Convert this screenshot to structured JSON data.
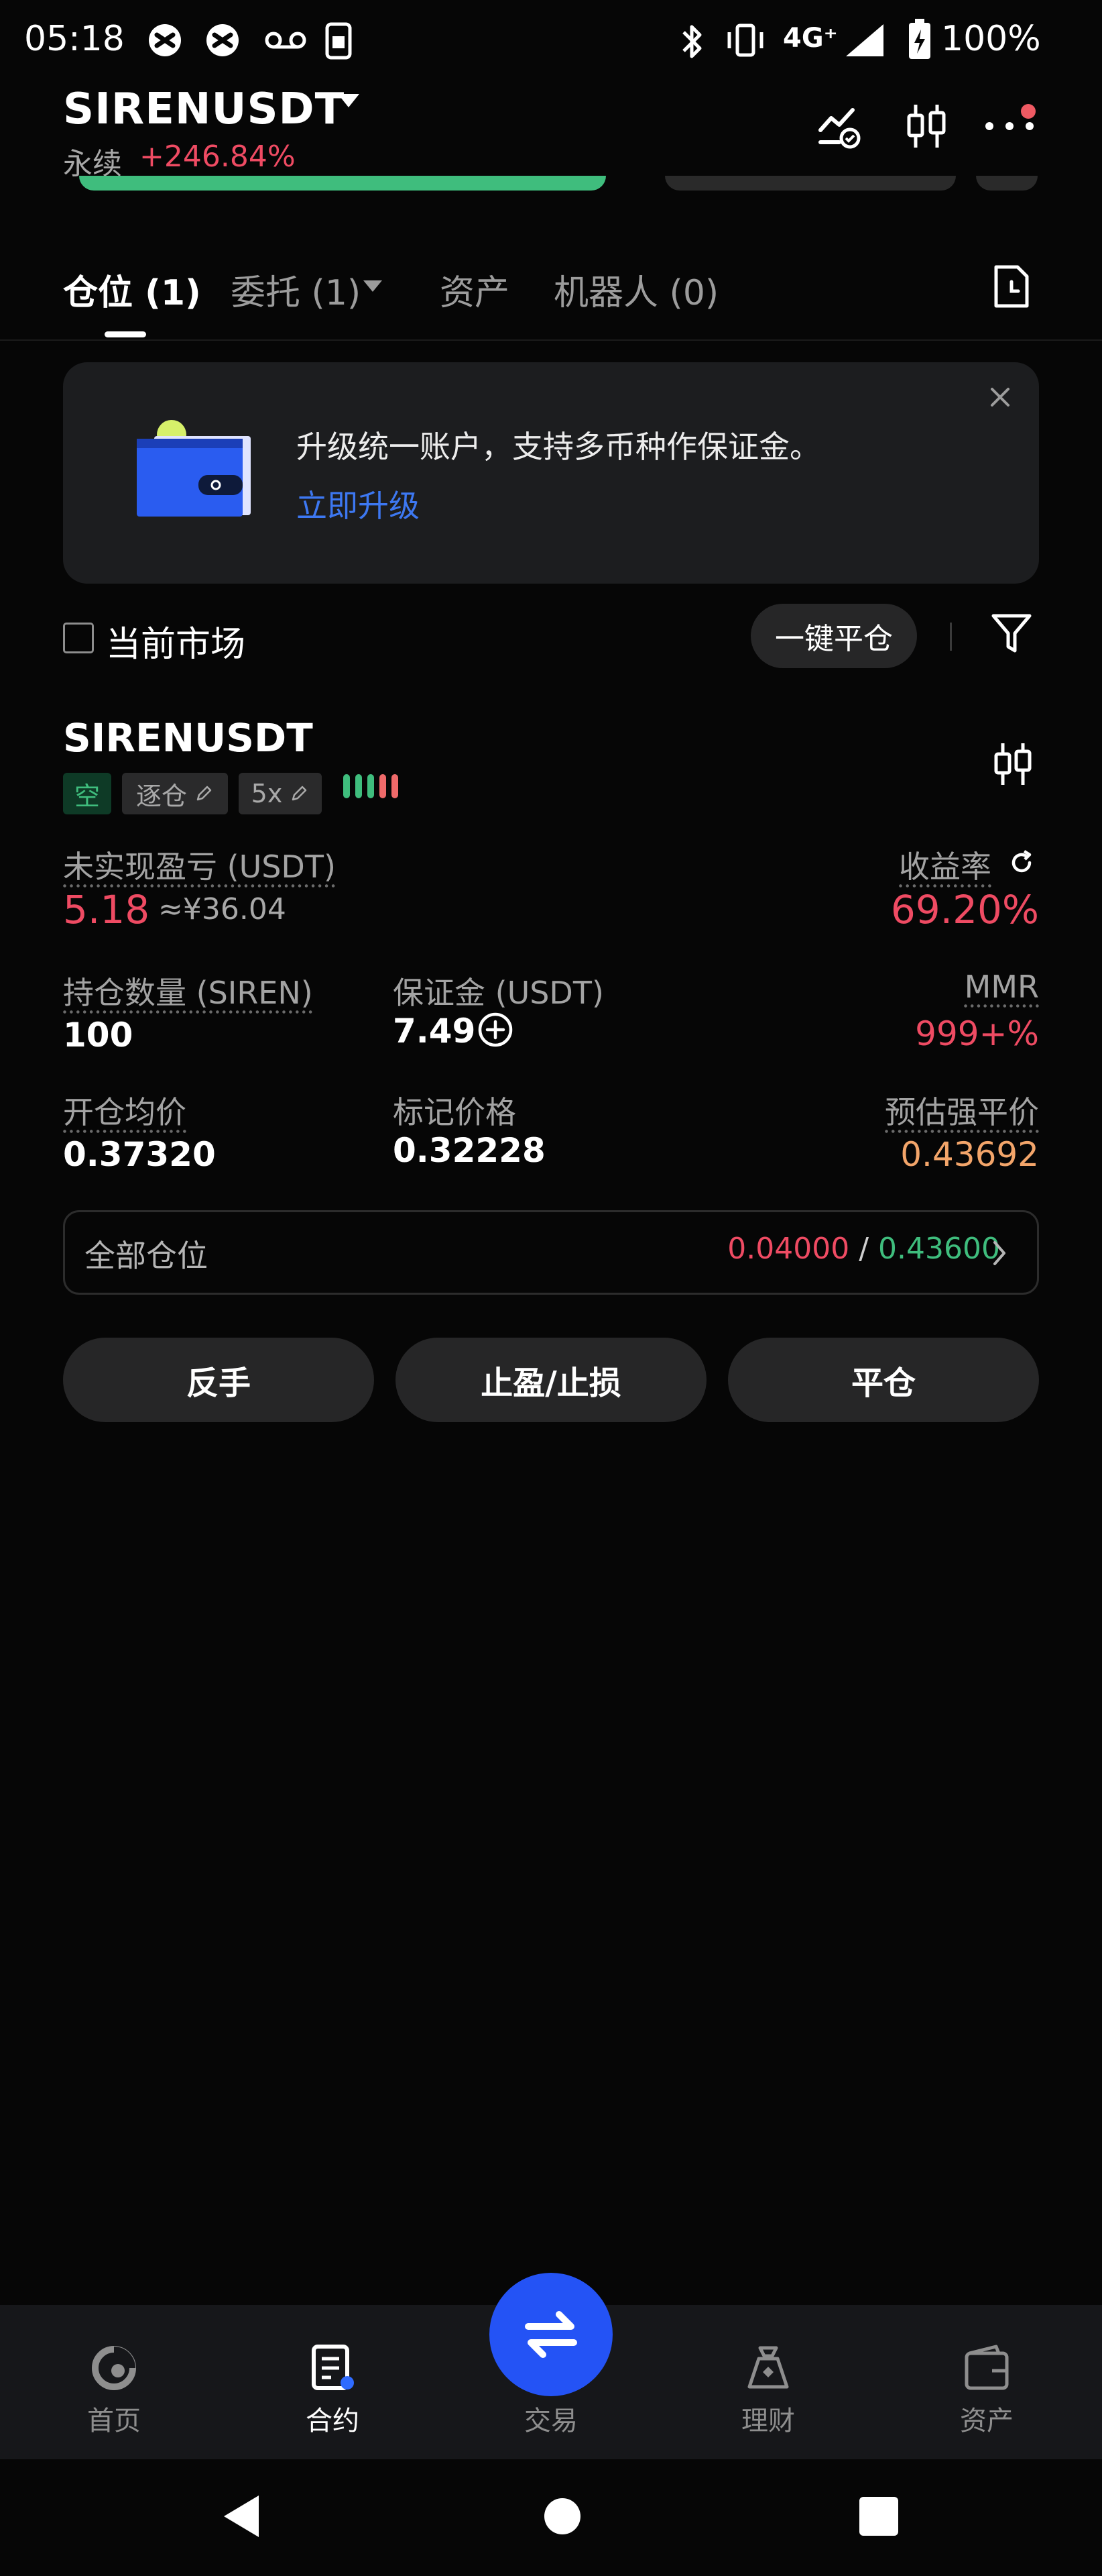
{
  "status_bar": {
    "time": "05:18",
    "network": "4G⁺",
    "battery": "100%",
    "icons": [
      "app-notification-icon",
      "app-notification-icon",
      "voicemail-icon",
      "sim-icon",
      "bluetooth-icon",
      "vibrate-icon",
      "signal-icon",
      "battery-charging-icon"
    ]
  },
  "header": {
    "pair": "SIRENUSDT",
    "contract_type": "永续",
    "change": "+246.84%",
    "icons": [
      "chart-alert-icon",
      "candlestick-icon",
      "more-icon"
    ]
  },
  "tabs": [
    {
      "label": "仓位 (1)",
      "active": true
    },
    {
      "label": "委托 (1)",
      "active": false
    },
    {
      "label": "资产",
      "active": false
    },
    {
      "label": "机器人 (0)",
      "active": false
    }
  ],
  "upgrade_banner": {
    "title": "升级统一账户，支持多币种作保证金。",
    "link": "立即升级"
  },
  "filter": {
    "current_market_label": "当前市场",
    "close_all_button": "一键平仓"
  },
  "position": {
    "symbol": "SIRENUSDT",
    "side_tag": "空",
    "margin_mode_tag": "逐仓",
    "leverage_tag": "5x",
    "unrealized_pnl_label": "未实现盈亏 (USDT)",
    "unrealized_pnl": "5.18",
    "unrealized_pnl_cny": "≈¥36.04",
    "roe_label": "收益率",
    "roe": "69.20%",
    "size_label": "持仓数量 (SIREN)",
    "size": "100",
    "margin_label": "保证金 (USDT)",
    "margin": "7.49",
    "mmr_label": "MMR",
    "mmr": "999+%",
    "entry_price_label": "开仓均价",
    "entry_price": "0.37320",
    "mark_price_label": "标记价格",
    "mark_price": "0.32228",
    "liq_price_label": "预估强平价",
    "liq_price": "0.43692",
    "all_positions_label": "全部仓位",
    "tp_value": "0.04000",
    "separator": "/",
    "sl_value": "0.43600"
  },
  "actions": {
    "reverse": "反手",
    "tp_sl": "止盈/止损",
    "close": "平仓"
  },
  "bottom_nav": [
    {
      "label": "首页",
      "icon": "home-icon",
      "active": false
    },
    {
      "label": "合约",
      "icon": "futures-icon",
      "active": true
    },
    {
      "label": "交易",
      "icon": "swap-icon",
      "active": false
    },
    {
      "label": "理财",
      "icon": "earn-icon",
      "active": false
    },
    {
      "label": "资产",
      "icon": "wallet-icon",
      "active": false
    }
  ],
  "colors": {
    "accent_blue": "#2453f5",
    "link_blue": "#3d78f2",
    "loss_red": "#ef4b63",
    "profit_green": "#3fbd7d",
    "liq_orange": "#f3a56a",
    "background": "#060606",
    "card": "#1c1d1f"
  }
}
